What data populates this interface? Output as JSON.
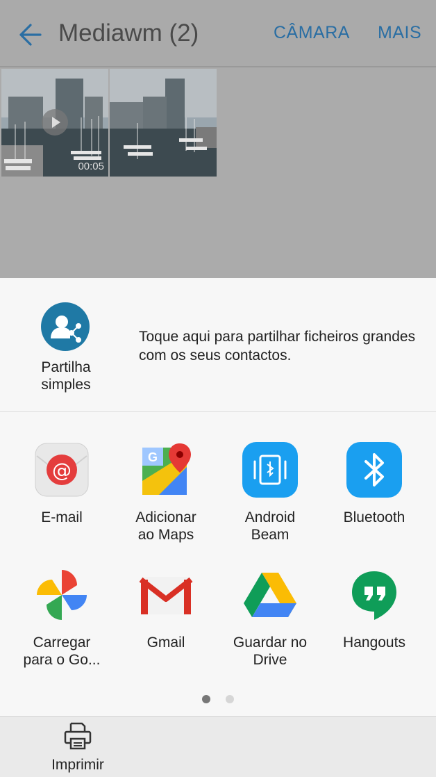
{
  "appbar": {
    "title": "Mediawm (2)",
    "camera_label": "CÂMARA",
    "more_label": "MAIS"
  },
  "thumbnails": [
    {
      "type": "video",
      "duration": "00:05"
    },
    {
      "type": "photo"
    }
  ],
  "share_sheet": {
    "simple_share": {
      "label": "Partilha simples",
      "description": "Toque aqui para partilhar ficheiros grandes com os seus contactos."
    },
    "apps": [
      {
        "label_line1": "E-mail",
        "label_line2": "",
        "icon": "email-icon"
      },
      {
        "label_line1": "Adicionar",
        "label_line2": "ao Maps",
        "icon": "maps-icon"
      },
      {
        "label_line1": "Android",
        "label_line2": "Beam",
        "icon": "android-beam-icon"
      },
      {
        "label_line1": "Bluetooth",
        "label_line2": "",
        "icon": "bluetooth-icon"
      },
      {
        "label_line1": "Carregar",
        "label_line2": "para o Go...",
        "icon": "google-photos-icon"
      },
      {
        "label_line1": "Gmail",
        "label_line2": "",
        "icon": "gmail-icon"
      },
      {
        "label_line1": "Guardar no",
        "label_line2": "Drive",
        "icon": "drive-icon"
      },
      {
        "label_line1": "Hangouts",
        "label_line2": "",
        "icon": "hangouts-icon"
      }
    ],
    "page_indicator": {
      "current": 1,
      "total": 2
    },
    "print_label": "Imprimir"
  },
  "colors": {
    "accent": "#2a6ea3",
    "scrim": "#aaaaaa",
    "sheet_bg": "#f7f7f7"
  }
}
